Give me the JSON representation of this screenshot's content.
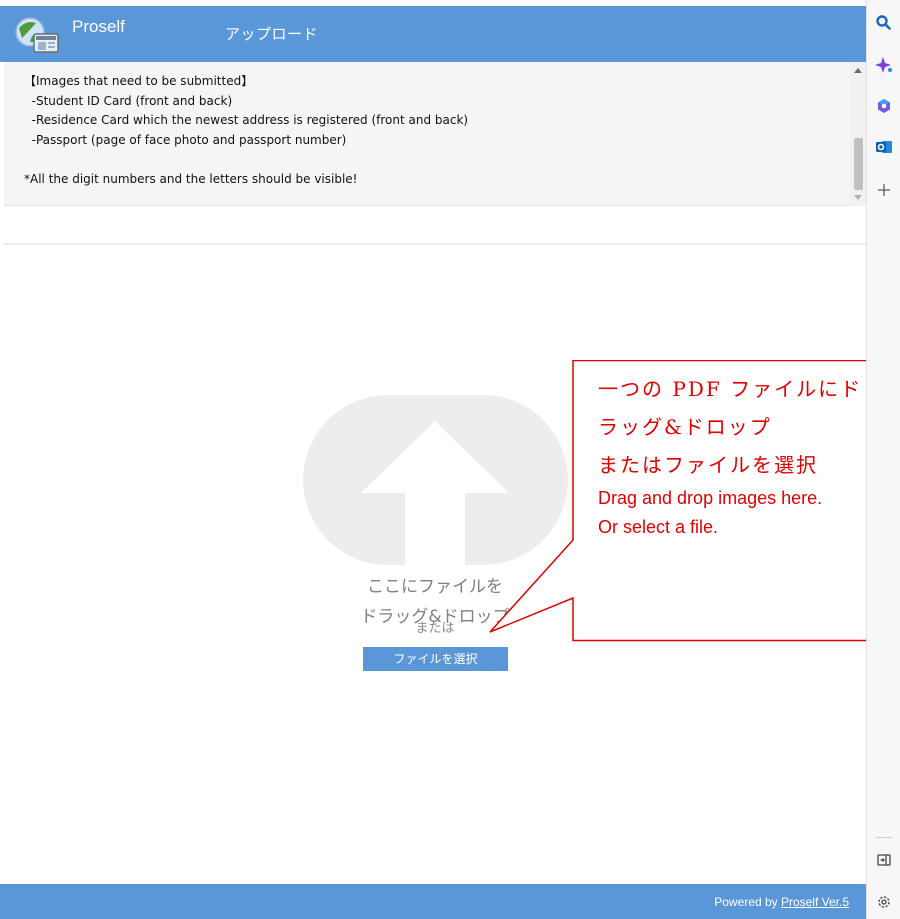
{
  "header": {
    "app_name": "Proself",
    "page_title": "アップロード"
  },
  "notice": {
    "lines": [
      "【Images that need to be submitted】",
      "  -Student ID Card (front and back)",
      "  -Residence Card which the newest address is registered (front and back)",
      "  -Passport (page of face photo and passport number)",
      "",
      "*All the digit numbers and the letters should be visible!"
    ]
  },
  "upload": {
    "drop_line1": "ここにファイルを",
    "drop_line2": "ドラッグ&ドロップ",
    "or": "または",
    "select_button": "ファイルを選択"
  },
  "callout": {
    "jp_line1": "一つの PDF ファイルにド",
    "jp_line2": "ラッグ&ドロップ",
    "jp_line3": "またはファイルを選択",
    "en_line1": "Drag and drop images here.",
    "en_line2": "Or select a file."
  },
  "footer": {
    "powered_by": "Powered by ",
    "link": "Proself Ver.5"
  },
  "sidebar": {
    "icons": [
      "search-icon",
      "sparkle-icon",
      "copilot-icon",
      "outlook-icon",
      "add-icon",
      "split-screen-icon",
      "settings-icon"
    ]
  },
  "colors": {
    "header": "#5a97d9",
    "callout": "#e00000",
    "upload_icon": "#ededed"
  }
}
